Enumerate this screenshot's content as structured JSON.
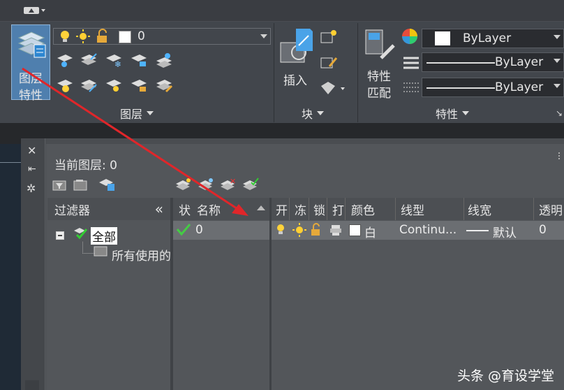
{
  "ribbon": {
    "layer_props_label_line1": "图层",
    "layer_props_label_line2": "特性",
    "current_layer_value": "0",
    "panel_layer_title": "图层",
    "insert_label": "插入",
    "panel_block_title": "块",
    "match_props_line1": "特性",
    "match_props_line2": "匹配",
    "panel_props_title": "特性",
    "color_value": "ByLayer",
    "linetype_value": "ByLayer",
    "lineweight_value": "ByLayer"
  },
  "palette": {
    "current_layer_label": "当前图层: 0",
    "filter_header": "过滤器",
    "filter_collapse": "«",
    "tree_all": "全部",
    "tree_used": "所有使用的",
    "columns": [
      "状",
      "名称",
      "开",
      "冻",
      "锁",
      "打",
      "颜色",
      "线型",
      "线宽",
      "透明"
    ],
    "row": {
      "name": "0",
      "color_name": "白",
      "linetype": "Continu...",
      "lineweight": "默认",
      "transparency": "0"
    }
  },
  "footer_watermark": "头条 @育设学堂",
  "colors": {
    "accent_blue": "#3d7fc4",
    "arrow_red": "#e0262a",
    "row_bg": "#6b6e72"
  }
}
